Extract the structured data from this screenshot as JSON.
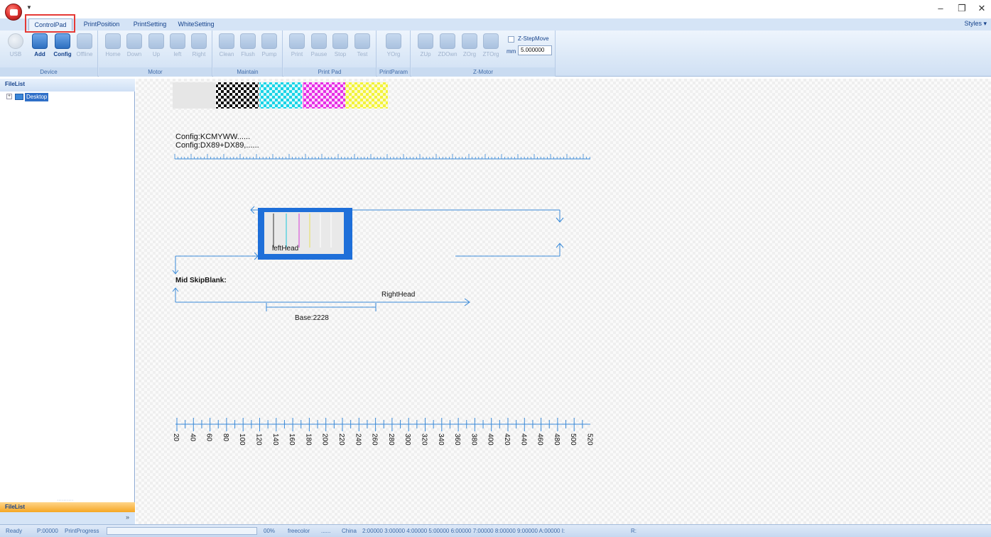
{
  "ribbon_tabs": [
    "ControlPad",
    "PrintPosition",
    "PrintSetting",
    "WhiteSetting"
  ],
  "styles_label": "Styles",
  "groups": {
    "device": {
      "label": "Device",
      "buttons": [
        "USB",
        "Add",
        "Config",
        "Offline"
      ]
    },
    "motor": {
      "label": "Motor",
      "buttons": [
        "Home",
        "Down",
        "Up",
        "left",
        "Right"
      ]
    },
    "maintain": {
      "label": "Maintain",
      "buttons": [
        "Clean",
        "Flush",
        "Pump"
      ]
    },
    "print_pad": {
      "label": "Print Pad",
      "buttons": [
        "Print",
        "Pause",
        "Stop",
        "Test"
      ]
    },
    "print_param": {
      "label": "PrintParam",
      "buttons": [
        "YOrg"
      ]
    },
    "z_motor": {
      "label": "Z-Motor",
      "buttons": [
        "ZUp",
        "ZDOwn",
        "ZOrg",
        "ZTOrg"
      ],
      "step_label": "Z-StepMove",
      "unit": "mm",
      "value": "5.000000"
    }
  },
  "left_panel": {
    "header": "FileList",
    "tree_root": "Desktop",
    "bottom_tab": "FileList",
    "more": "»"
  },
  "canvas": {
    "config_line1": "Config:KCMYWW......",
    "config_line2": "Config:DX89+DX89,......",
    "left_head": "leftHead",
    "mid_skip": "Mid SkipBlank:",
    "right_head": "RightHead",
    "base": "Base:2228",
    "ruler_labels": [
      "20",
      "40",
      "60",
      "80",
      "100",
      "120",
      "140",
      "160",
      "180",
      "200",
      "220",
      "240",
      "260",
      "280",
      "300",
      "320",
      "340",
      "360",
      "380",
      "400",
      "420",
      "440",
      "460",
      "480",
      "500",
      "520"
    ]
  },
  "status": {
    "ready": "Ready",
    "position": "P:00000",
    "progress_label": "PrintProgress",
    "percent": "00%",
    "freecolor": "freecolor",
    "dashes": "......",
    "region": "China",
    "channels": "2:00000 3:00000 4:00000 5:00000 6:00000 7:00000 8:00000 9:00000 A:00000 I:",
    "r_label": "R:",
    "progress_fraction": 0
  },
  "colors": {
    "accent": "#2f7de0",
    "head_frame": "#1e6fd9",
    "line": "#3a8ad8",
    "highlight": "#e53935"
  }
}
